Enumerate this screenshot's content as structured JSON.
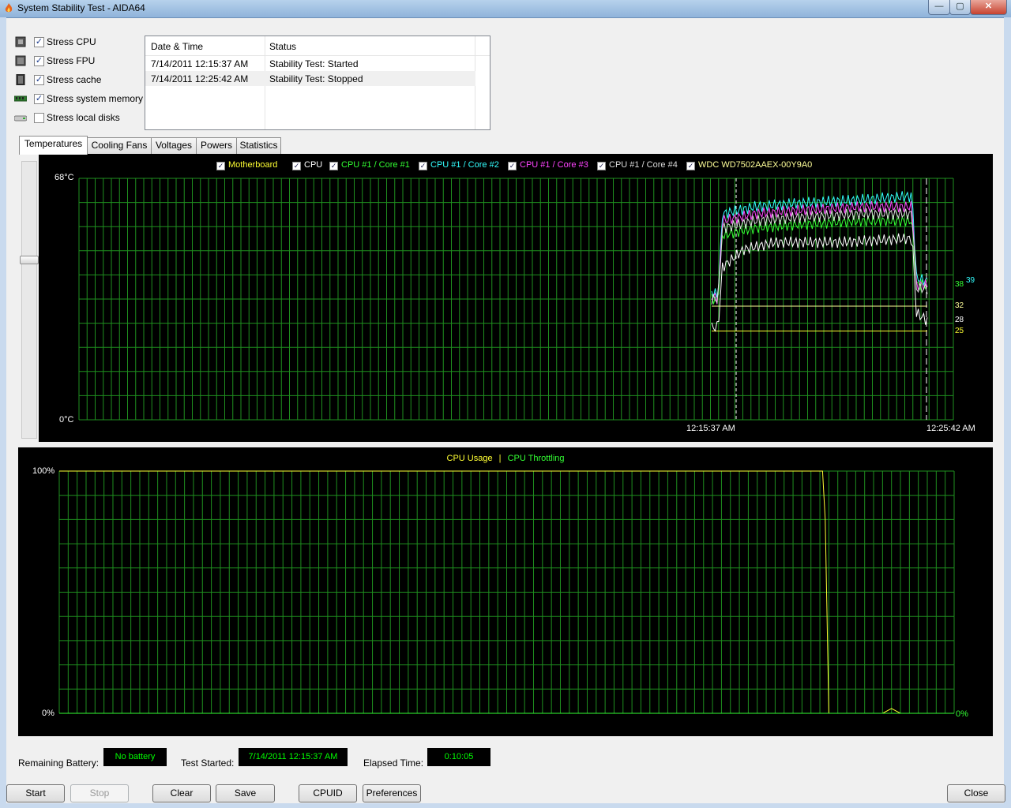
{
  "window": {
    "title": "System Stability Test - AIDA64",
    "minimize_symbol": "—",
    "maximize_symbol": "▢",
    "close_symbol": "✕"
  },
  "stress_options": [
    {
      "label": "Stress CPU",
      "checked": true,
      "icon": "cpu-icon"
    },
    {
      "label": "Stress FPU",
      "checked": true,
      "icon": "fpu-icon"
    },
    {
      "label": "Stress cache",
      "checked": true,
      "icon": "cache-icon"
    },
    {
      "label": "Stress system memory",
      "checked": true,
      "icon": "memory-icon"
    },
    {
      "label": "Stress local disks",
      "checked": false,
      "icon": "disk-icon"
    }
  ],
  "log": {
    "columns": [
      "Date & Time",
      "Status"
    ],
    "rows": [
      {
        "datetime": "7/14/2011 12:15:37 AM",
        "status": "Stability Test: Started"
      },
      {
        "datetime": "7/14/2011 12:25:42 AM",
        "status": "Stability Test: Stopped"
      }
    ]
  },
  "tabs": [
    {
      "label": "Temperatures",
      "active": true
    },
    {
      "label": "Cooling Fans",
      "active": false
    },
    {
      "label": "Voltages",
      "active": false
    },
    {
      "label": "Powers",
      "active": false
    },
    {
      "label": "Statistics",
      "active": false
    }
  ],
  "chart_data": [
    {
      "type": "line",
      "title": "",
      "ylim": [
        0,
        68
      ],
      "y_top_label": "68°C",
      "y_bottom_label": "0°C",
      "x_markers": [
        "12:15:37 AM",
        "12:25:42 AM"
      ],
      "grid": true,
      "series": [
        {
          "name": "Motherboard",
          "color": "#ffff33",
          "current": 25,
          "points": [
            [
              0,
              25
            ],
            [
              0.03,
              25
            ],
            [
              0.06,
              25
            ],
            [
              0.97,
              25
            ],
            [
              1,
              25
            ]
          ]
        },
        {
          "name": "CPU",
          "color": "#ffffff",
          "current": 28,
          "points": [
            [
              0,
              26
            ],
            [
              0.03,
              26
            ],
            [
              0.05,
              43
            ],
            [
              0.15,
              48
            ],
            [
              0.3,
              50
            ],
            [
              0.6,
              50
            ],
            [
              0.9,
              51
            ],
            [
              0.93,
              51
            ],
            [
              0.95,
              30
            ],
            [
              1,
              28
            ]
          ]
        },
        {
          "name": "CPU #1 / Core #1",
          "color": "#33ff33",
          "current": 38,
          "points": [
            [
              0,
              34
            ],
            [
              0.03,
              34
            ],
            [
              0.05,
              52
            ],
            [
              0.2,
              54
            ],
            [
              0.4,
              55
            ],
            [
              0.7,
              56
            ],
            [
              0.93,
              56
            ],
            [
              0.95,
              38
            ],
            [
              1,
              38
            ]
          ]
        },
        {
          "name": "CPU #1 / Core #2",
          "color": "#33ffff",
          "current": 39,
          "points": [
            [
              0,
              36
            ],
            [
              0.03,
              35
            ],
            [
              0.05,
              58
            ],
            [
              0.2,
              60
            ],
            [
              0.4,
              61
            ],
            [
              0.7,
              62
            ],
            [
              0.93,
              63
            ],
            [
              0.95,
              40
            ],
            [
              1,
              39
            ]
          ]
        },
        {
          "name": "CPU #1 / Core #3",
          "color": "#ff44ff",
          "current": 38,
          "points": [
            [
              0,
              35
            ],
            [
              0.03,
              34
            ],
            [
              0.05,
              56
            ],
            [
              0.2,
              58
            ],
            [
              0.4,
              59
            ],
            [
              0.7,
              60
            ],
            [
              0.93,
              60
            ],
            [
              0.95,
              38
            ],
            [
              1,
              38
            ]
          ]
        },
        {
          "name": "CPU #1 / Core #4",
          "color": "#dddddd",
          "current": null,
          "points": [
            [
              0,
              34
            ],
            [
              0.03,
              34
            ],
            [
              0.05,
              54
            ],
            [
              0.2,
              56
            ],
            [
              0.4,
              57
            ],
            [
              0.7,
              58
            ],
            [
              0.93,
              58
            ],
            [
              0.95,
              37
            ],
            [
              1,
              37
            ]
          ]
        },
        {
          "name": "WDC WD7502AAEX-00Y9A0",
          "color": "#ffff99",
          "current": 32,
          "points": [
            [
              0,
              32
            ],
            [
              0.03,
              32
            ],
            [
              0.06,
              32
            ],
            [
              0.97,
              32
            ],
            [
              1,
              32
            ]
          ]
        }
      ],
      "right_value_labels": [
        {
          "text": "39",
          "color": "#33ffff",
          "value": 39
        },
        {
          "text": "38",
          "color": "#33ff33",
          "value": 38
        },
        {
          "text": "32",
          "color": "#ffff99",
          "value": 32
        },
        {
          "text": "28",
          "color": "#ffffff",
          "value": 28
        },
        {
          "text": "25",
          "color": "#ffff33",
          "value": 25
        }
      ]
    },
    {
      "type": "line",
      "title": "",
      "legend": [
        {
          "name": "CPU Usage",
          "color": "#ffff33"
        },
        {
          "name": "CPU Throttling",
          "color": "#33ff33"
        }
      ],
      "separator": "|",
      "ylim": [
        0,
        100
      ],
      "y_top_label": "100%",
      "y_bottom_label": "0%",
      "throttling_label": "0%",
      "grid": true,
      "series": [
        {
          "name": "CPU Usage",
          "color": "#ffff33",
          "points": [
            [
              0,
              100
            ],
            [
              0.853,
              100
            ],
            [
              0.856,
              80
            ],
            [
              0.86,
              0
            ],
            [
              0.92,
              0
            ],
            [
              0.93,
              2
            ],
            [
              0.94,
              0
            ],
            [
              1,
              0
            ]
          ]
        },
        {
          "name": "CPU Throttling",
          "color": "#33ff33",
          "points": [
            [
              0,
              0
            ],
            [
              1,
              0
            ]
          ]
        }
      ]
    }
  ],
  "status_bar": {
    "battery_label": "Remaining Battery:",
    "battery_value": "No battery",
    "started_label": "Test Started:",
    "started_value": "7/14/2011 12:15:37 AM",
    "elapsed_label": "Elapsed Time:",
    "elapsed_value": "0:10:05"
  },
  "buttons": {
    "start": "Start",
    "stop": "Stop",
    "clear": "Clear",
    "save": "Save",
    "cpuid": "CPUID",
    "preferences": "Preferences",
    "close": "Close"
  }
}
